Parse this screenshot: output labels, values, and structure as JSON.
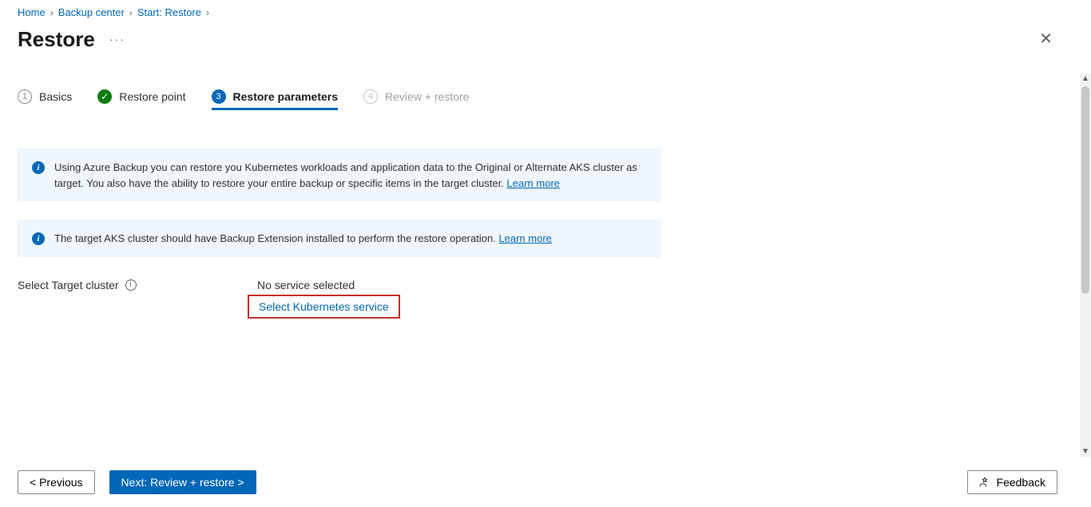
{
  "breadcrumb": {
    "items": [
      "Home",
      "Backup center",
      "Start: Restore"
    ]
  },
  "title": "Restore",
  "wizard": {
    "steps": [
      {
        "num": "1",
        "label": "Basics",
        "state": "pending"
      },
      {
        "num": "✓",
        "label": "Restore point",
        "state": "done"
      },
      {
        "num": "3",
        "label": "Restore parameters",
        "state": "active"
      },
      {
        "num": "4",
        "label": "Review + restore",
        "state": "disabled"
      }
    ]
  },
  "info1": {
    "text": "Using Azure Backup you can restore you Kubernetes workloads and application data to the Original or Alternate AKS cluster as target. You also have the ability to restore your entire backup or specific items in the target cluster. ",
    "link": "Learn more"
  },
  "info2": {
    "text": "The target AKS cluster should have Backup Extension installed to perform the restore operation. ",
    "link": "Learn more"
  },
  "field": {
    "label": "Select Target cluster",
    "value": "No service selected",
    "action": "Select Kubernetes service"
  },
  "footer": {
    "prev": "< Previous",
    "next": "Next: Review + restore >",
    "feedback": "Feedback"
  }
}
